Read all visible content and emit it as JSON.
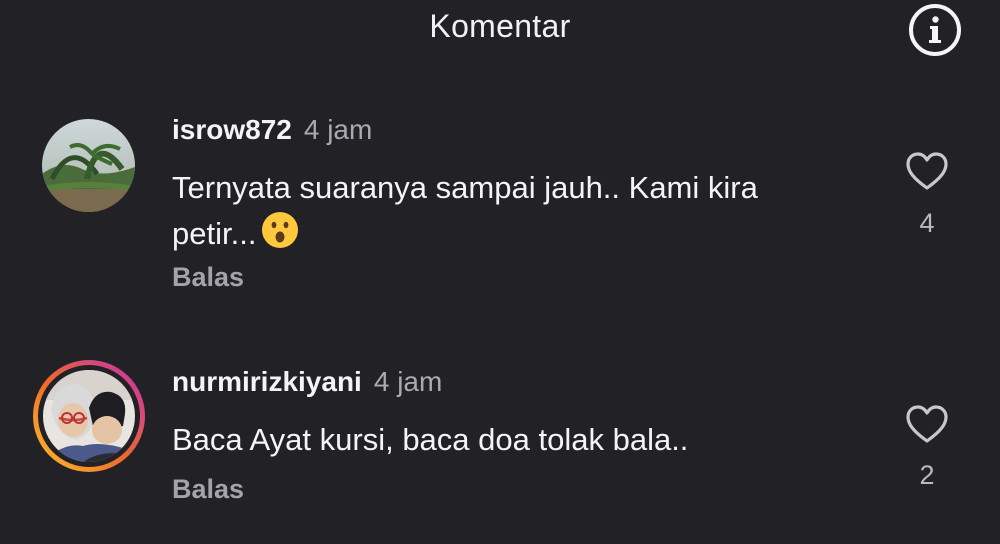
{
  "header": {
    "title": "Komentar",
    "info_icon": "info-icon"
  },
  "comments": [
    {
      "username": "isrow872",
      "time": "4 jam",
      "text": "Ternyata suaranya sampai jauh.. Kami kira petir...",
      "emoji": "😮",
      "reply_label": "Balas",
      "like_count": "4"
    },
    {
      "username": "nurmirizkiyani",
      "time": "4 jam",
      "text": "Baca Ayat kursi, baca doa tolak bala..",
      "reply_label": "Balas",
      "like_count": "2"
    }
  ],
  "colors": {
    "background": "#222125",
    "text": "#f4f4f4",
    "muted": "#a3a3aa",
    "story_ring_start": "#f9c52b",
    "story_ring_end": "#c22fb2"
  }
}
